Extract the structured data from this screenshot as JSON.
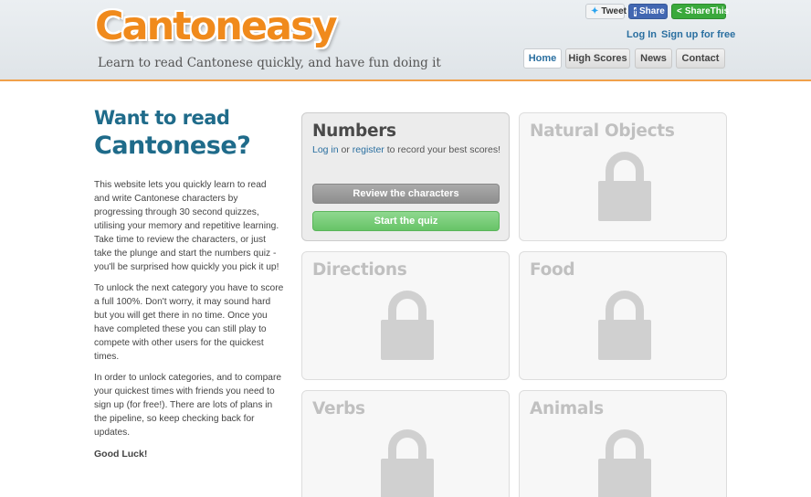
{
  "brand": {
    "logo": "Cantoneasy",
    "tagline": "Learn to read Cantonese quickly, and have fun doing it"
  },
  "social": {
    "tweet": "Tweet",
    "share": "Share",
    "sharethis": "ShareThis"
  },
  "auth": {
    "login": "Log In",
    "signup": "Sign up for free"
  },
  "nav": [
    {
      "label": "Home"
    },
    {
      "label": "High Scores"
    },
    {
      "label": "News"
    },
    {
      "label": "Contact"
    }
  ],
  "intro": {
    "heading_line1": "Want to read",
    "heading_line2": "Cantonese?",
    "p1": "This website lets you quickly learn to read and write Cantonese characters by progressing through 30 second quizzes, utilising your memory and repetitive learning. Take time to review the characters, or just take the plunge and start the numbers quiz - you'll be surprised how quickly you pick it up!",
    "p2": "To unlock the next category you have to score a full 100%. Don't worry, it may sound hard but you will get there in no time. Once you have completed these you can still play to compete with other users for the quickest times.",
    "p3": "In order to unlock categories, and to compare your quickest times with friends you need to sign up (for free!). There are lots of plans in the pipeline, so keep checking back for updates.",
    "signoff": "Good Luck!"
  },
  "categories": [
    {
      "title": "Numbers",
      "status": "unlocked",
      "login_text": "Log in",
      "or_text": "or",
      "register_text": "register",
      "suffix_text": "to record your best scores!",
      "review_label": "Review the characters",
      "quiz_label": "Start the quiz"
    },
    {
      "title": "Natural Objects",
      "status": "locked"
    },
    {
      "title": "Directions",
      "status": "locked"
    },
    {
      "title": "Food",
      "status": "locked"
    },
    {
      "title": "Verbs",
      "status": "locked"
    },
    {
      "title": "Animals",
      "status": "locked"
    }
  ],
  "colors": {
    "accent": "#f08a1c",
    "heading": "#1f6b8a",
    "link": "#2a6fa0",
    "quiz_button": "#67c467"
  },
  "icons": {
    "locked": "padlock-icon",
    "tweet": "twitter-bird-icon",
    "share": "facebook-icon",
    "sharethis": "share-icon"
  }
}
